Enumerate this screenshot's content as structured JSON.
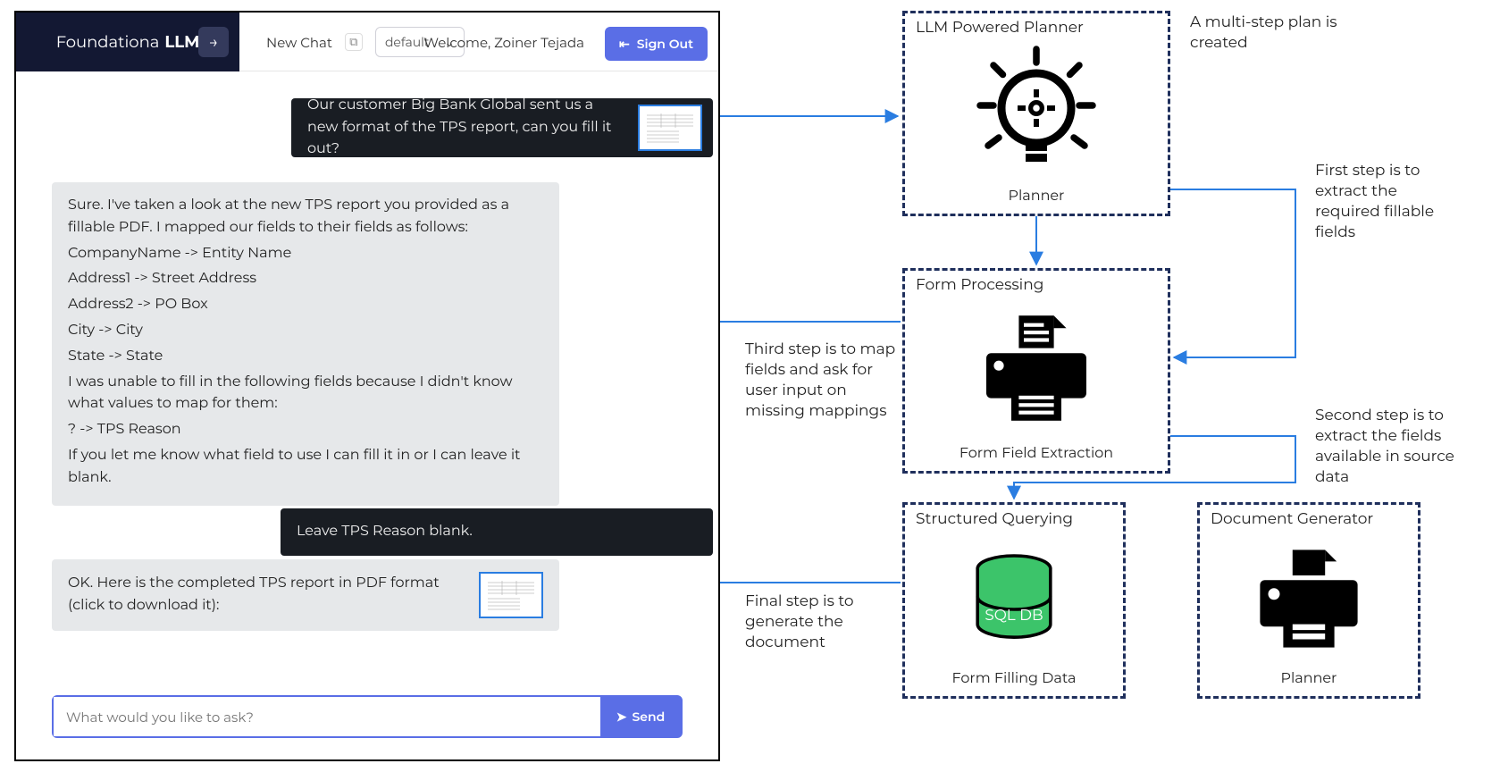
{
  "chat": {
    "brand_prefix": "Foundationa",
    "brand_suffix": "LLM",
    "new_chat_label": "New Chat",
    "model_select": "default",
    "welcome_label": "Welcome, Zoiner Tejada",
    "sign_out_label": "Sign Out",
    "msg1_text": "Our customer Big Bank Global sent us a new format of the TPS report, can you fill it out?",
    "msg2": {
      "l0": "Sure. I've taken a look at the new TPS report you provided as a fillable PDF. I mapped our fields to their fields as follows:",
      "l1": "CompanyName -> Entity Name",
      "l2": "Address1 -> Street Address",
      "l3": "Address2 -> PO Box",
      "l4": "City -> City",
      "l5": "State -> State",
      "l6": "I was unable to fill in the following fields because I didn't know what values to map for them:",
      "l7": "? -> TPS Reason",
      "l8": "If you let me know what field to use I can fill it in or I can leave it blank."
    },
    "msg3_text": "Leave TPS Reason blank.",
    "msg4_text": "OK. Here is the completed TPS report in PDF format (click to download it):",
    "input_placeholder": "What would you like to ask?",
    "send_label": "Send"
  },
  "diagram": {
    "planner_title": "LLM Powered Planner",
    "planner_caption": "Planner",
    "form_title": "Form Processing",
    "form_caption": "Form Field Extraction",
    "query_title": "Structured Querying",
    "query_db_label": "SQL DB",
    "query_caption": "Form Filling Data",
    "gen_title": "Document Generator",
    "gen_caption": "Planner",
    "annot_plan": "A multi-step plan is created",
    "annot_step1": "First step is to extract the required fillable fields",
    "annot_step2": "Second step is to extract the fields available in source data",
    "annot_step3": "Third step is to map fields and ask for user input on missing mappings",
    "annot_final": "Final step is to generate the document"
  }
}
